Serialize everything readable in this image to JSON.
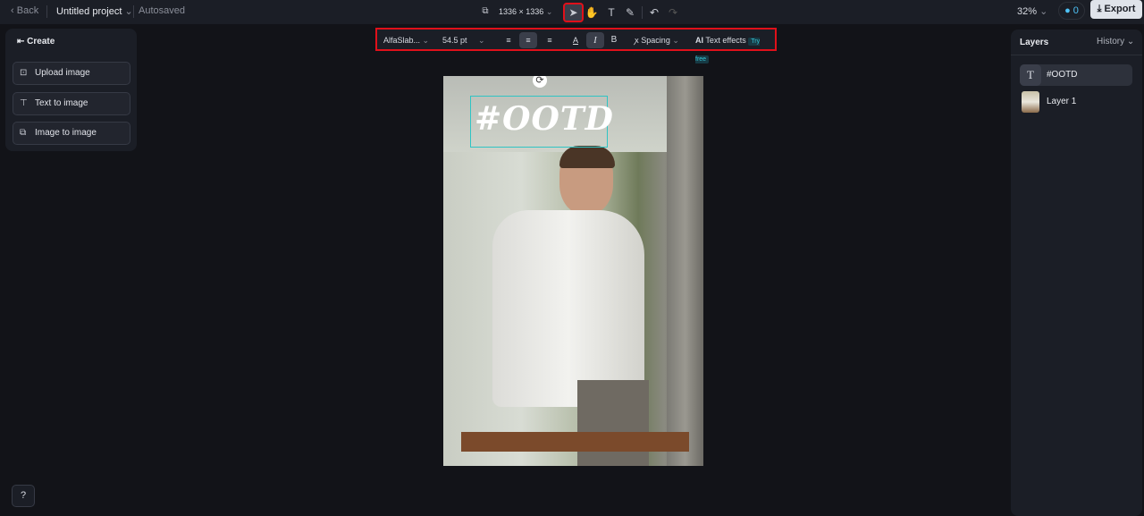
{
  "topbar": {
    "back": "Back",
    "project": "Untitled project",
    "status": "Autosaved",
    "canvas_size": "1336 × 1336",
    "zoom": "32%",
    "credits": "0",
    "export": "Export"
  },
  "left_panel": {
    "title": "Create",
    "items": [
      "Upload image",
      "Text to image",
      "Image to image"
    ]
  },
  "text_toolbar": {
    "font": "AlfaSlab...",
    "size": "54.5 pt",
    "spacing": "Spacing",
    "text_effects": "Text effects",
    "badge": "Try free"
  },
  "canvas": {
    "text": "#OOTD"
  },
  "right_panel": {
    "title": "Layers",
    "history": "History",
    "layers": [
      "#OOTD",
      "Layer 1"
    ]
  },
  "colors": {
    "accent": "#2fc4c4",
    "highlight": "#e0101a"
  }
}
